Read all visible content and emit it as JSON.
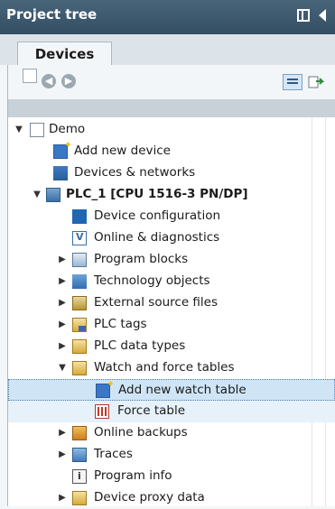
{
  "panel": {
    "title": "Project tree",
    "tab_label": "Devices"
  },
  "toolbar": {
    "icons": [
      "new-doc-icon",
      "back-icon",
      "forward-icon",
      "list-view-icon",
      "sync-icon"
    ]
  },
  "tree": {
    "rows": [
      {
        "label": "Demo",
        "icon": "project-icon",
        "expanded": true
      },
      {
        "label": "Add new device",
        "icon": "add-device-icon"
      },
      {
        "label": "Devices & networks",
        "icon": "network-icon"
      },
      {
        "label": "PLC_1 [CPU 1516-3 PN/DP]",
        "icon": "plc-icon",
        "expanded": true
      },
      {
        "label": "Device configuration",
        "icon": "device-config-icon"
      },
      {
        "label": "Online & diagnostics",
        "icon": "diagnostics-icon"
      },
      {
        "label": "Program blocks",
        "icon": "program-blocks-icon",
        "expanded": false
      },
      {
        "label": "Technology objects",
        "icon": "technology-objects-icon",
        "expanded": false
      },
      {
        "label": "External source files",
        "icon": "external-source-icon",
        "expanded": false
      },
      {
        "label": "PLC tags",
        "icon": "plc-tags-icon",
        "expanded": false
      },
      {
        "label": "PLC data types",
        "icon": "plc-data-types-icon",
        "expanded": false
      },
      {
        "label": "Watch and force tables",
        "icon": "watch-force-icon",
        "expanded": true
      },
      {
        "label": "Add new watch table",
        "icon": "add-watch-table-icon",
        "selected": true
      },
      {
        "label": "Force table",
        "icon": "force-table-icon"
      },
      {
        "label": "Online backups",
        "icon": "online-backups-icon",
        "expanded": false
      },
      {
        "label": "Traces",
        "icon": "traces-icon",
        "expanded": false
      },
      {
        "label": "Program info",
        "icon": "program-info-icon"
      },
      {
        "label": "Device proxy data",
        "icon": "device-proxy-icon",
        "expanded": false
      }
    ]
  }
}
